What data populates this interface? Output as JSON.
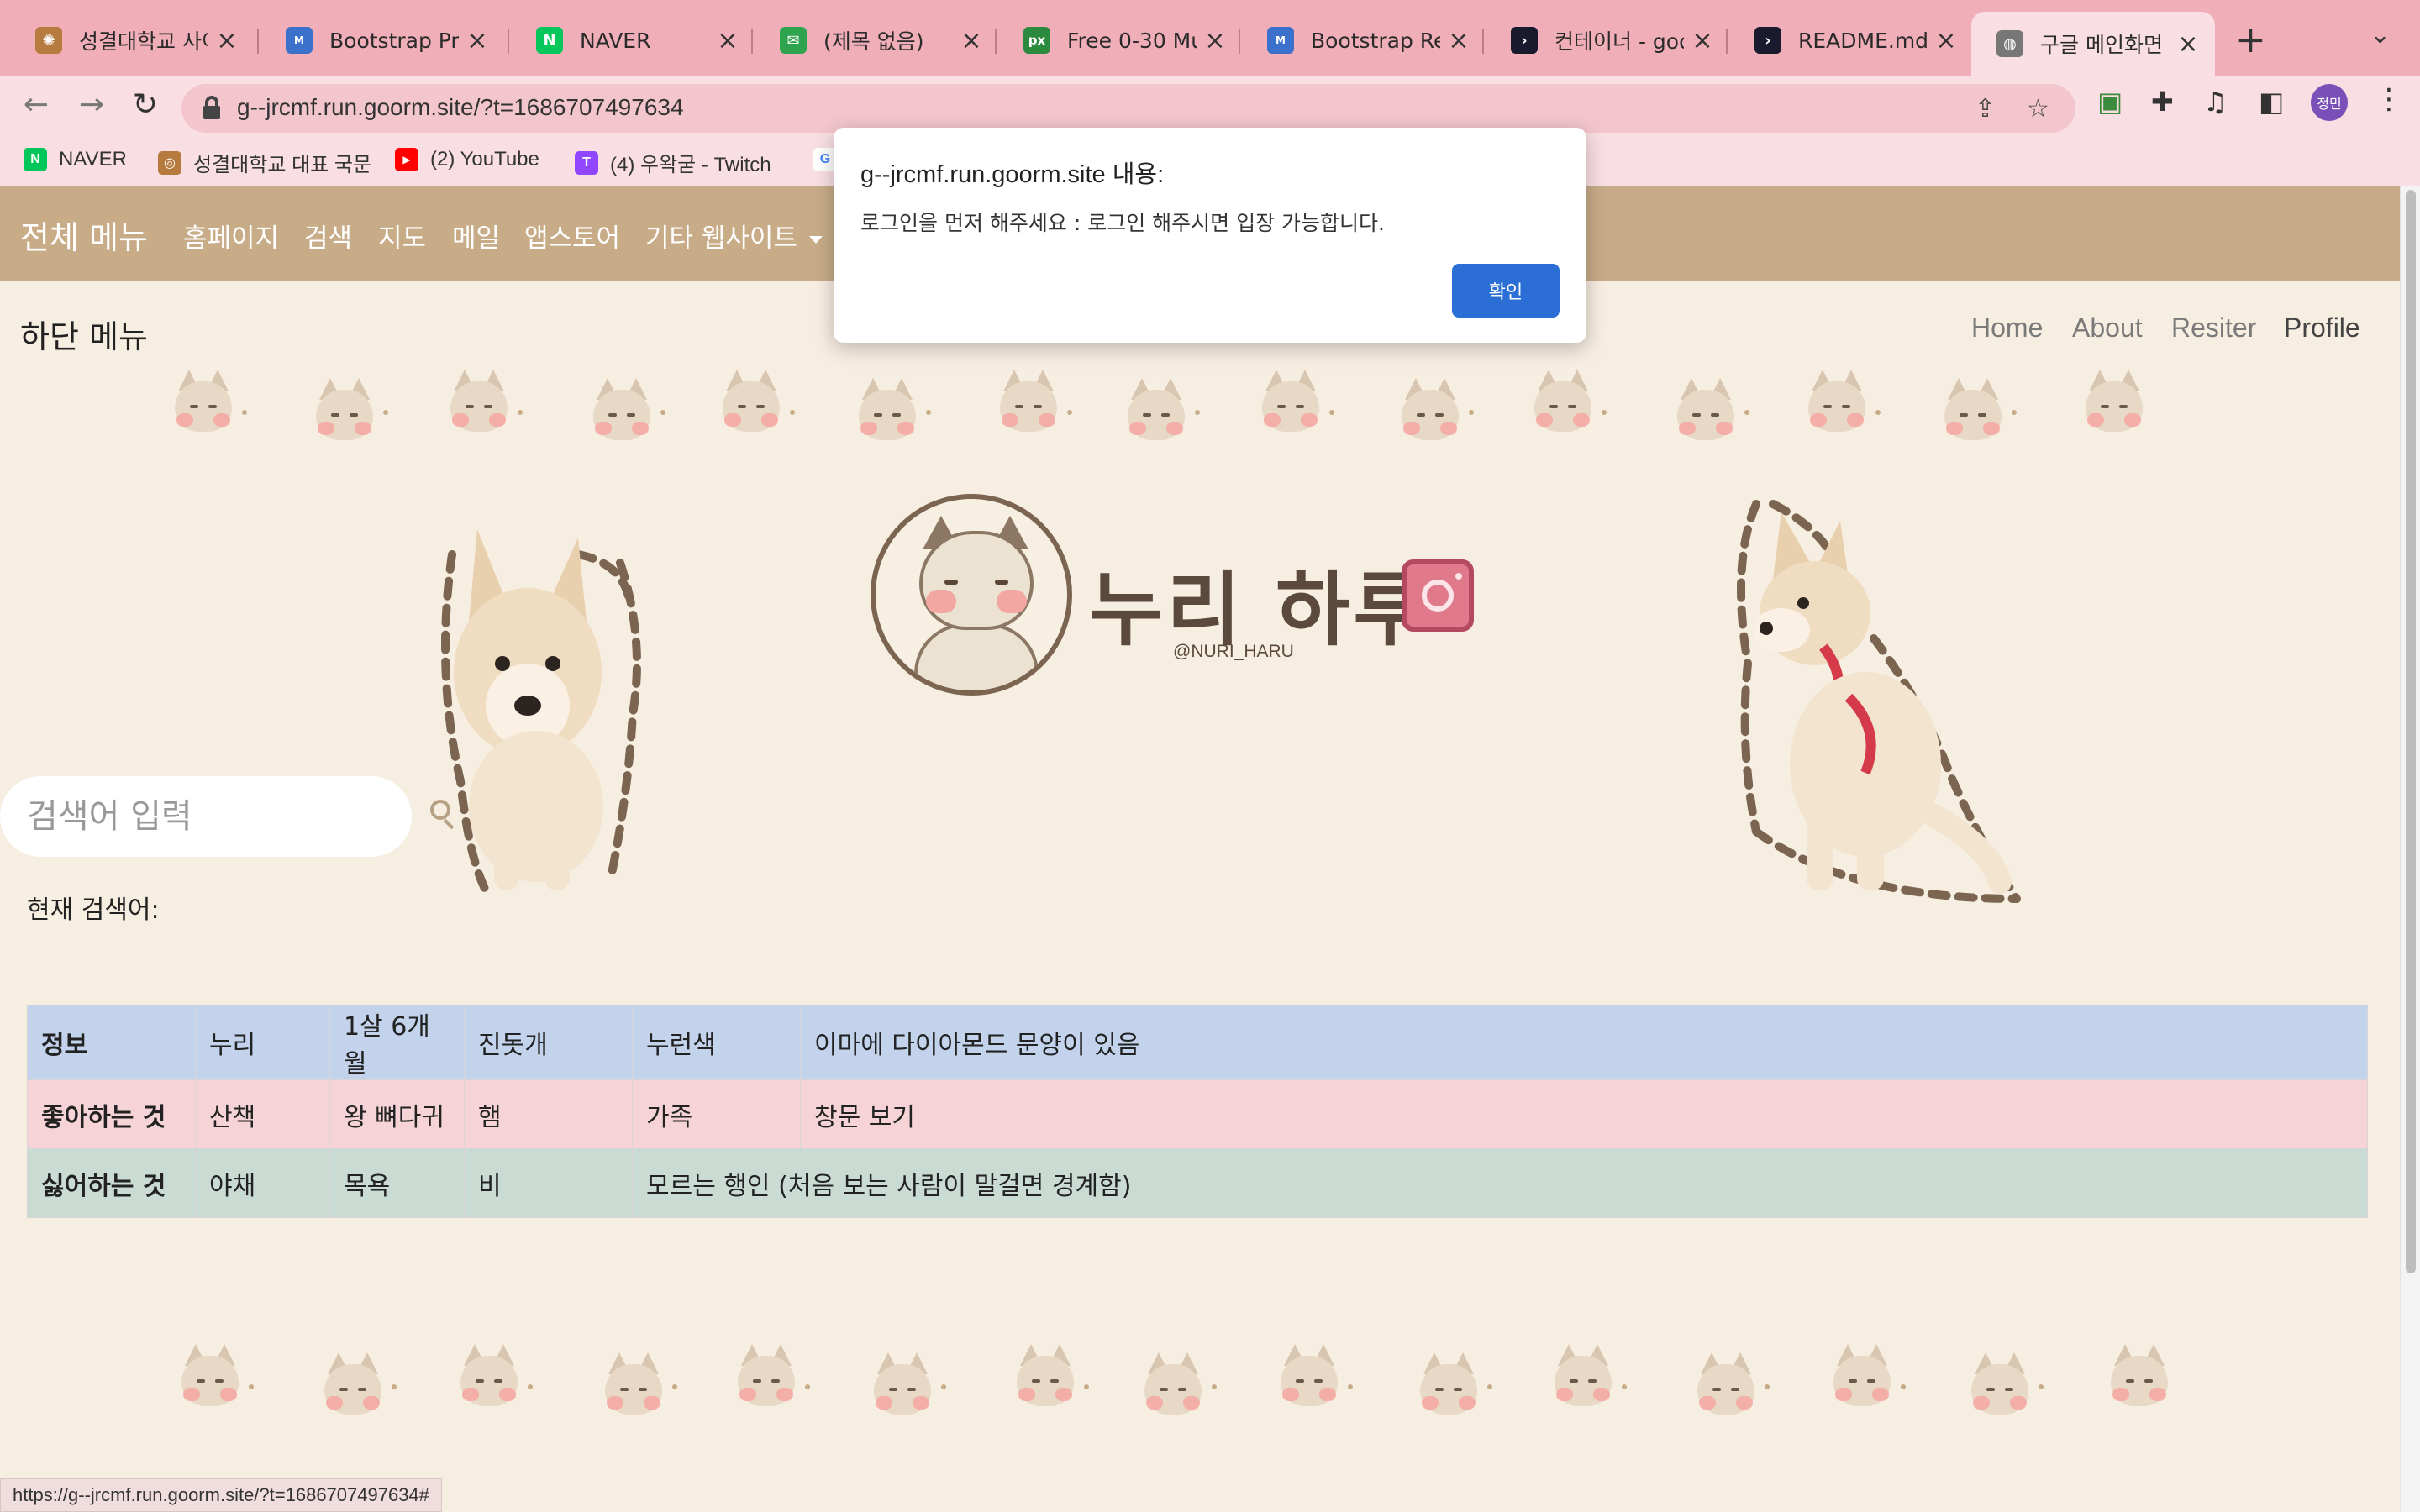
{
  "browser": {
    "tabs": [
      {
        "label": "성결대학교 사이버",
        "favicon": "seal-icon",
        "color": "#b77b3f"
      },
      {
        "label": "Bootstrap Prof",
        "favicon": "mdb-icon",
        "color": "#3b71ca"
      },
      {
        "label": "NAVER",
        "favicon": "naver-icon",
        "color": "#03c75a"
      },
      {
        "label": "(제목 없음)",
        "favicon": "mail-icon",
        "color": "#2ea44f"
      },
      {
        "label": "Free 0-30 Mu",
        "favicon": "px-icon",
        "color": "#2c8a3e"
      },
      {
        "label": "Bootstrap Reg",
        "favicon": "mdb-icon",
        "color": "#3b71ca"
      },
      {
        "label": "컨테이너 - goor",
        "favicon": "terminal-icon",
        "color": "#1a1a2e"
      },
      {
        "label": "README.md (",
        "favicon": "terminal-icon",
        "color": "#1a1a2e"
      },
      {
        "label": "구글 메인화면 예",
        "favicon": "globe-icon",
        "color": "#555555"
      }
    ],
    "url": "g--jrcmf.run.goorm.site/?t=1686707497634",
    "profile_initials": "정민",
    "bookmarks": [
      {
        "label": "NAVER",
        "color": "#03c75a",
        "glyph": "N"
      },
      {
        "label": "성결대학교 대표 국문",
        "color": "#b77b3f",
        "glyph": "◎"
      },
      {
        "label": "(2) YouTube",
        "color": "#ff0000",
        "glyph": "▶"
      },
      {
        "label": "(4) 우왁굳 - Twitch",
        "color": "#9146ff",
        "glyph": "T"
      },
      {
        "label": "",
        "color": "#4285f4",
        "glyph": "G"
      }
    ],
    "status_url": "https://g--jrcmf.run.goorm.site/?t=1686707497634#"
  },
  "navbar": {
    "brand": "전체 메뉴",
    "links": [
      "홈페이지",
      "검색",
      "지도",
      "메일",
      "앱스토어"
    ],
    "dropdown": "기타 웹사이트"
  },
  "subnav": {
    "title": "하단 메뉴",
    "links": [
      "Home",
      "About",
      "Resiter",
      "Profile"
    ]
  },
  "logo": {
    "title": "누리 하루",
    "handle": "@NURI_HARU"
  },
  "search": {
    "placeholder": "검색어 입력",
    "current_label": "현재 검색어:"
  },
  "table": {
    "rows": [
      [
        "정보",
        "누리",
        "1살 6개월",
        "진돗개",
        "누런색",
        "이마에 다이아몬드 문양이 있음"
      ],
      [
        "좋아하는 것",
        "산책",
        "왕 뼈다귀",
        "햄",
        "가족",
        "창문 보기"
      ],
      [
        "싫어하는 것",
        "야채",
        "목욕",
        "비",
        "모르는 행인 (처음 보는 사람이 말걸면 경계함)"
      ]
    ],
    "row_colors": [
      "#c3d3ec",
      "#f5d3d6",
      "#c9dbd2"
    ]
  },
  "dialog": {
    "title": "g--jrcmf.run.goorm.site 내용:",
    "message": "로그인을 먼저 해주세요 : 로그인 해주시면 입장 가능합니다.",
    "ok_label": "확인"
  },
  "colors": {
    "navbar": "#c8ac88",
    "page_bg": "#f7eee2",
    "tabbar": "#f0aeb8",
    "dialog_button": "#2b6fd6"
  }
}
